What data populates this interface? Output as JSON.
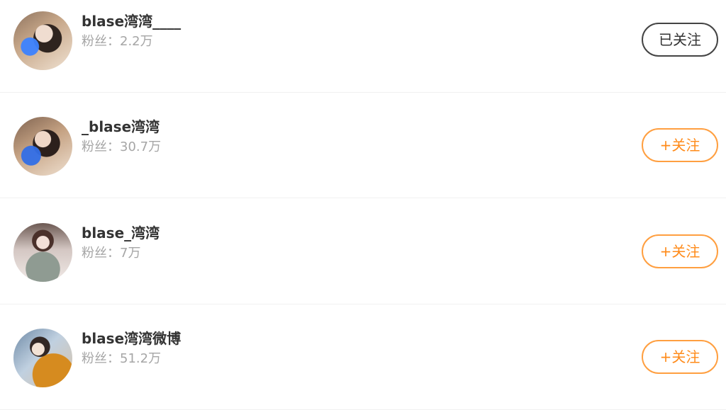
{
  "users": [
    {
      "name": "blase湾湾____",
      "fans_label": "粉丝：",
      "fans_count": "2.2万",
      "button_label": "已关注",
      "followed": true
    },
    {
      "name": "_blase湾湾",
      "fans_label": "粉丝：",
      "fans_count": "30.7万",
      "button_label": "+关注",
      "followed": false
    },
    {
      "name": "blase_湾湾",
      "fans_label": "粉丝：",
      "fans_count": "7万",
      "button_label": "+关注",
      "followed": false
    },
    {
      "name": "blase湾湾微博",
      "fans_label": "粉丝：",
      "fans_count": "51.2万",
      "button_label": "+关注",
      "followed": false
    }
  ],
  "colors": {
    "accent": "#ff8b1a",
    "secondary_text": "#a6a6a6",
    "primary_text": "#333333",
    "followed_border": "#444444"
  }
}
